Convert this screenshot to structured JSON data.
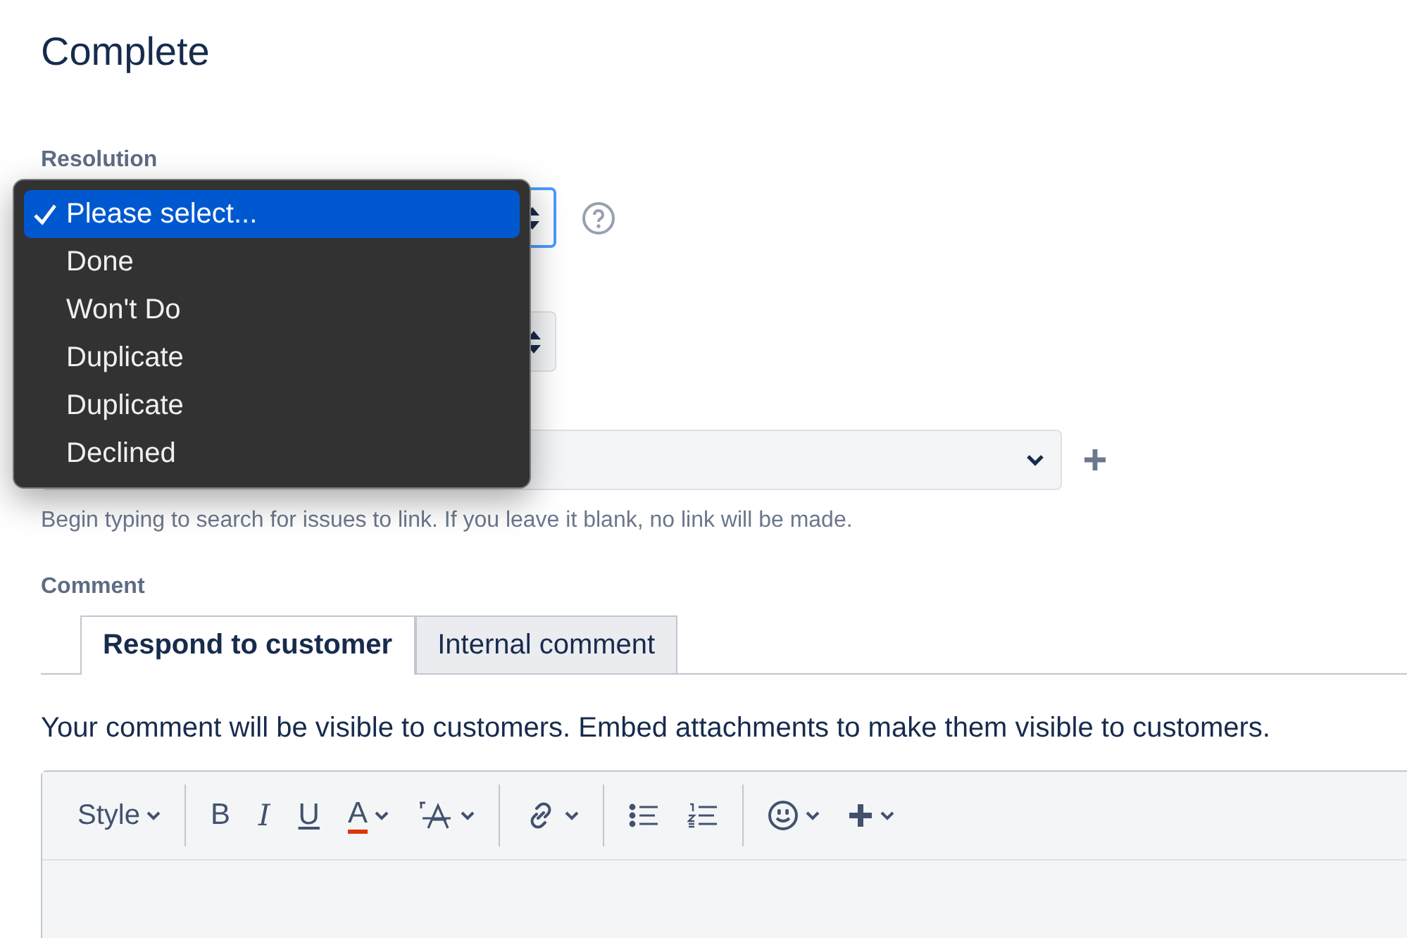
{
  "title": "Complete",
  "resolution": {
    "label": "Resolution",
    "focused": true,
    "menu": [
      {
        "label": "Please select...",
        "selected": true
      },
      {
        "label": "Done",
        "selected": false
      },
      {
        "label": "Won't Do",
        "selected": false
      },
      {
        "label": "Duplicate",
        "selected": false
      },
      {
        "label": "Duplicate",
        "selected": false
      },
      {
        "label": "Declined",
        "selected": false
      }
    ]
  },
  "second_select": {
    "focused": false
  },
  "link_field": {
    "help": "Begin typing to search for issues to link. If you leave it blank, no link will be made."
  },
  "comment": {
    "label": "Comment",
    "tabs": [
      {
        "label": "Respond to customer",
        "selected": true
      },
      {
        "label": "Internal comment",
        "selected": false
      }
    ],
    "notice": "Your comment will be visible to customers. Embed attachments to make them visible to customers.",
    "toolbar": [
      [
        {
          "kind": "style",
          "label": "Style"
        }
      ],
      [
        {
          "kind": "bold",
          "label": "B"
        },
        {
          "kind": "italic",
          "label": "I"
        },
        {
          "kind": "underline",
          "label": "U"
        },
        {
          "kind": "color",
          "label": "A"
        },
        {
          "kind": "effects"
        }
      ],
      [
        {
          "kind": "link"
        }
      ],
      [
        {
          "kind": "bullets"
        },
        {
          "kind": "numbers"
        }
      ],
      [
        {
          "kind": "emoji"
        },
        {
          "kind": "insert"
        }
      ]
    ]
  }
}
